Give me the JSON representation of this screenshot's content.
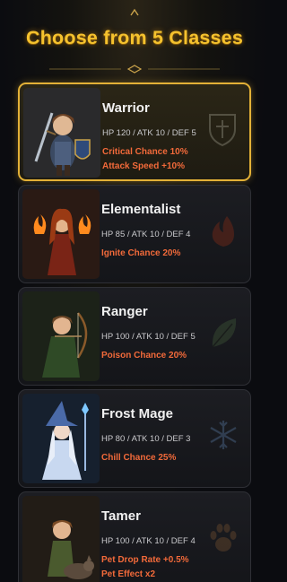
{
  "header": {
    "title": "Choose from 5 Classes"
  },
  "classes": [
    {
      "name": "Warrior",
      "stats": "HP 120 / ATK 10 / DEF 5",
      "perks": [
        "Critical Chance 10%",
        "Attack Speed +10%"
      ],
      "selected": true,
      "emblem": "shield-cross-icon"
    },
    {
      "name": "Elementalist",
      "stats": "HP 85 / ATK 10 / DEF 4",
      "perks": [
        "Ignite Chance 20%"
      ],
      "selected": false,
      "emblem": "flame-icon"
    },
    {
      "name": "Ranger",
      "stats": "HP 100 / ATK 10 / DEF 5",
      "perks": [
        "Poison Chance 20%"
      ],
      "selected": false,
      "emblem": "leaf-icon"
    },
    {
      "name": "Frost Mage",
      "stats": "HP 80 / ATK 10 / DEF 3",
      "perks": [
        "Chill Chance 25%"
      ],
      "selected": false,
      "emblem": "snowflake-icon"
    },
    {
      "name": "Tamer",
      "stats": "HP 100 / ATK 10 / DEF 4",
      "perks": [
        "Pet Drop Rate +0.5%",
        "Pet Effect x2"
      ],
      "selected": false,
      "emblem": "paw-print-icon"
    }
  ],
  "colors": {
    "title": "#f5c22e",
    "selected_border": "#e3b137",
    "perk_text": "#f26a3a"
  }
}
